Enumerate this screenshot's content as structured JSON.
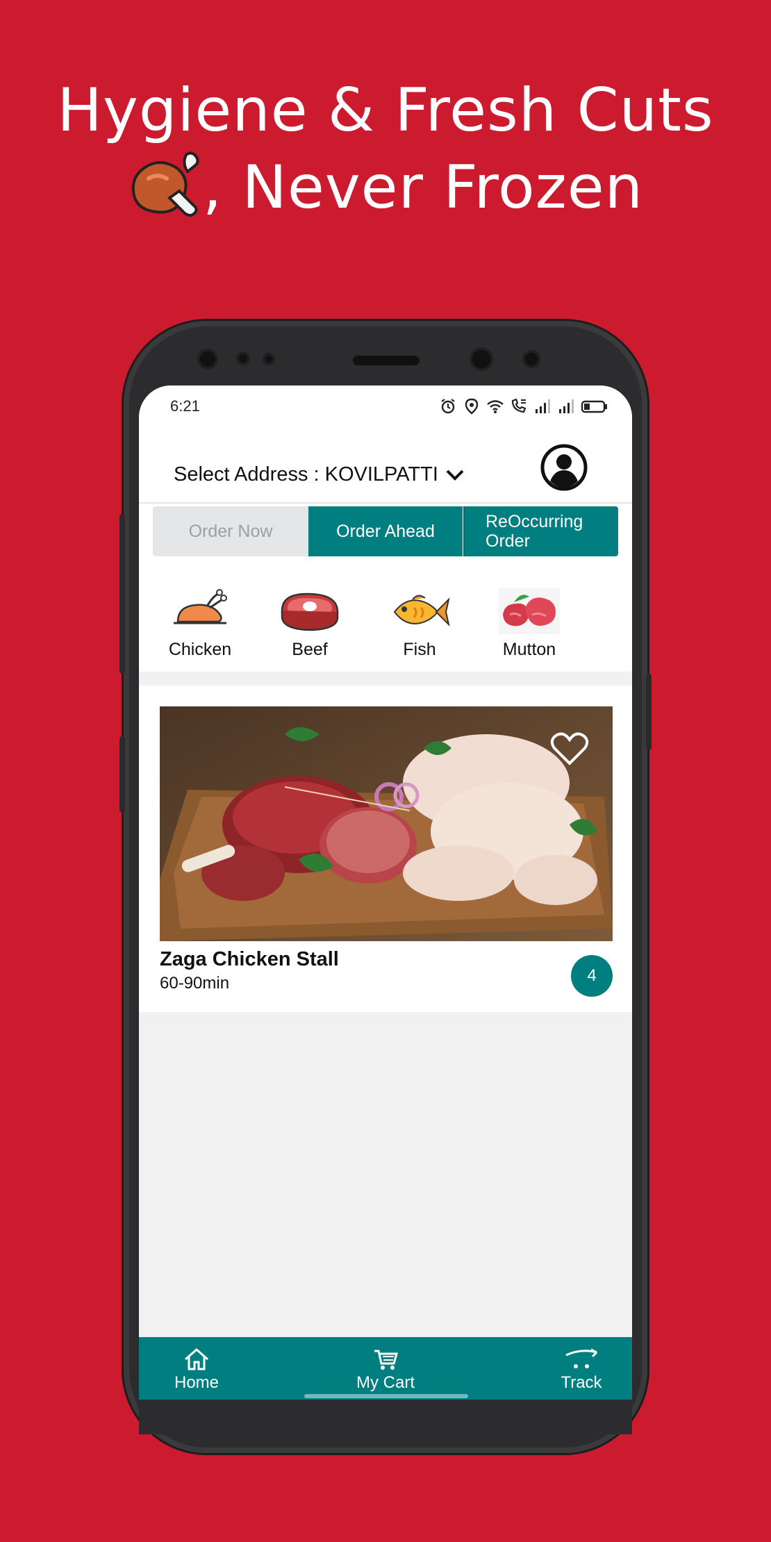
{
  "headline": {
    "line1": "Hygiene & Fresh Cuts",
    "line2": ", Never Frozen"
  },
  "status_bar": {
    "time": "6:21",
    "icons": [
      "alarm-icon",
      "location-icon",
      "wifi-icon",
      "call-icon",
      "signal-icon",
      "signal-icon",
      "battery-icon"
    ]
  },
  "header": {
    "address_label": "Select Address : KOVILPATTI",
    "avatar_icon": "user-icon"
  },
  "order_tabs": [
    {
      "label": "Order Now",
      "active": false
    },
    {
      "label": "Order Ahead",
      "active": true
    },
    {
      "label": "ReOccurring Order",
      "active": true
    }
  ],
  "categories": [
    {
      "label": "Chicken",
      "icon": "roast-chicken-icon"
    },
    {
      "label": "Beef",
      "icon": "steak-icon"
    },
    {
      "label": "Fish",
      "icon": "fish-icon"
    },
    {
      "label": "Mutton",
      "icon": "mutton-icon"
    }
  ],
  "store": {
    "name": "Zaga Chicken Stall",
    "time": "60-90min",
    "badge": "4",
    "favorite_icon": "heart-icon"
  },
  "bottom_nav": [
    {
      "label": "Home",
      "icon": "home-icon"
    },
    {
      "label": "My Cart",
      "icon": "cart-icon"
    },
    {
      "label": "Track",
      "icon": "delivery-icon"
    }
  ],
  "colors": {
    "background": "#CC1B2F",
    "accent": "#007E80"
  }
}
